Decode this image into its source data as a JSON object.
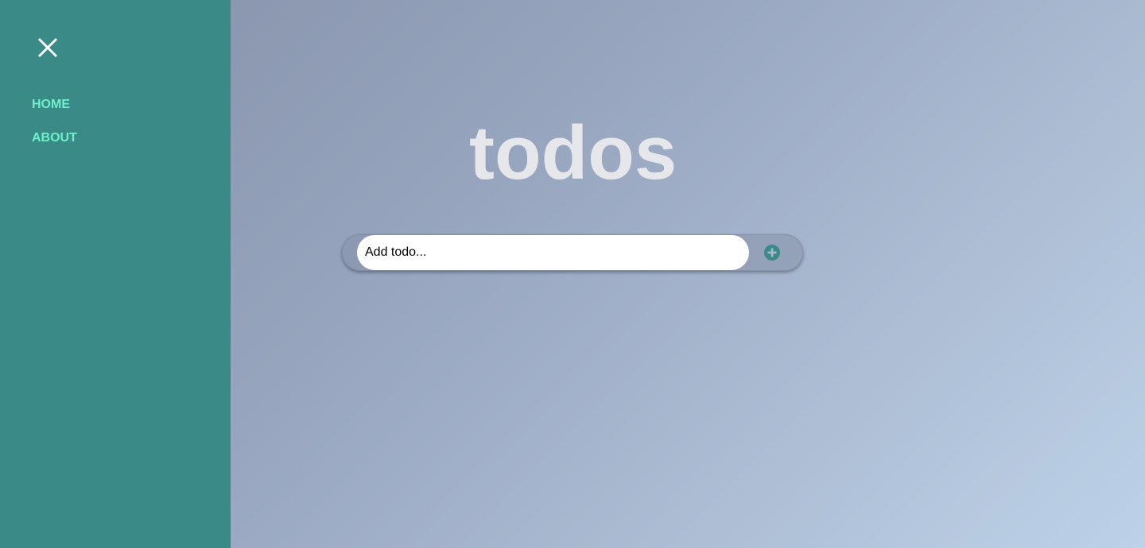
{
  "sidebar": {
    "close_icon": "close-icon",
    "items": [
      {
        "label": "HOME"
      },
      {
        "label": "ABOUT"
      }
    ],
    "background": "#3a8a87",
    "link_color": "#6ff0c9"
  },
  "main": {
    "title": "todos",
    "add_input": {
      "value": "",
      "placeholder": "Add todo..."
    },
    "add_icon": "plus-circle-icon",
    "accent": "#3a8a87"
  }
}
